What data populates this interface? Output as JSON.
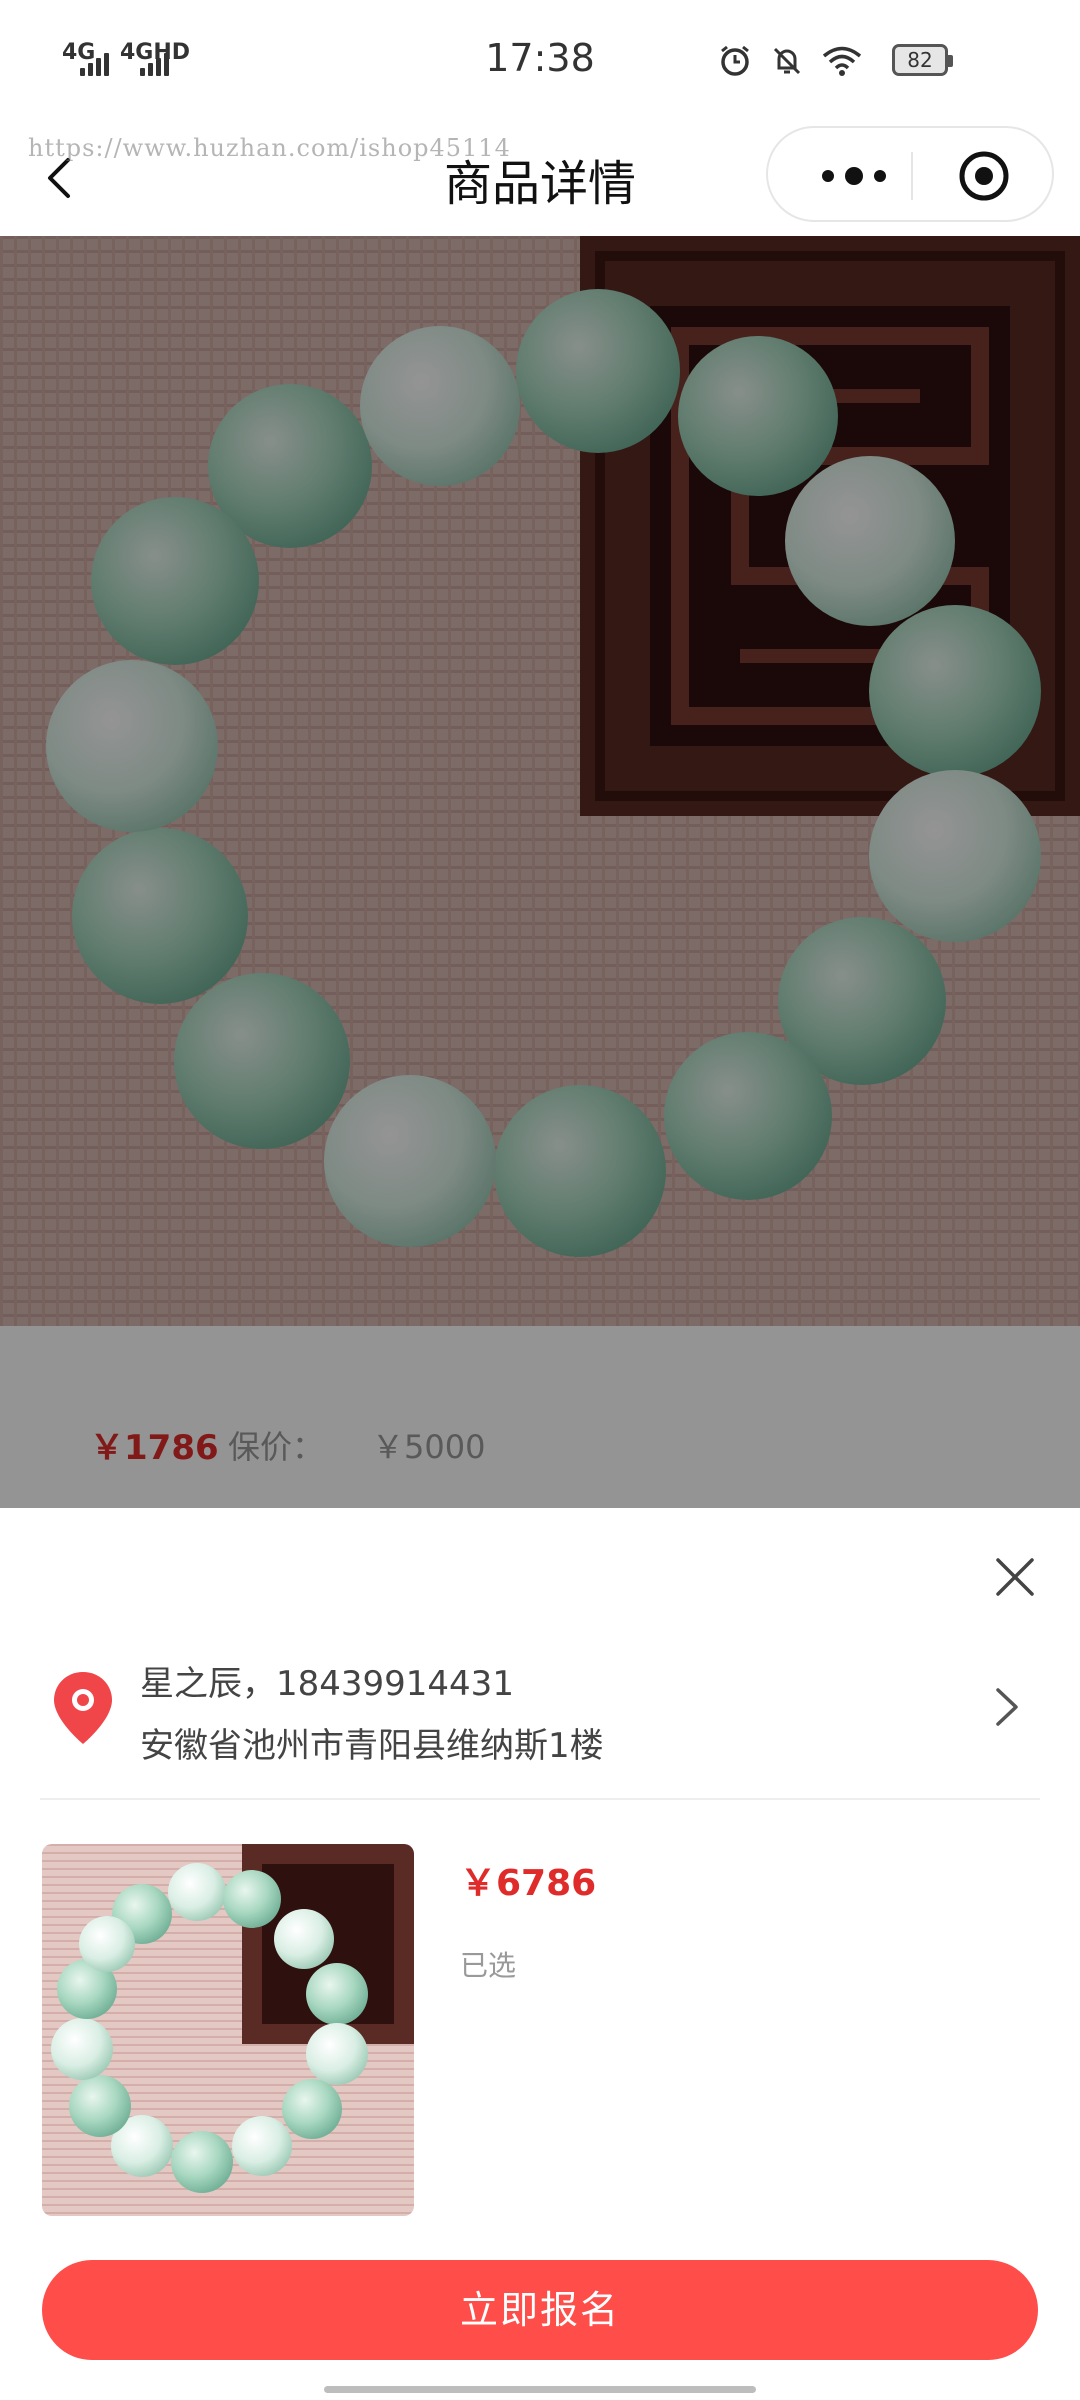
{
  "status_bar": {
    "network_1": "4G",
    "network_2": "4GHD",
    "time": "17:38",
    "battery": "82",
    "icons": [
      "alarm-icon",
      "mute-icon",
      "wifi-icon",
      "battery-icon"
    ]
  },
  "nav": {
    "title": "商品详情",
    "watermark": "https://www.huzhan.com/ishop45114",
    "icons": [
      "back-icon",
      "more-icon",
      "target-icon"
    ]
  },
  "product_card": {
    "price": "￥1786",
    "original_price_label": "保价：",
    "original_price": "￥5000"
  },
  "sheet": {
    "address": {
      "contact": "星之辰，18439914431",
      "detail": "安徽省池州市青阳县维纳斯1楼"
    },
    "price": "￥6786",
    "selected_label": "已选",
    "submit_label": "立即报名"
  },
  "colors": {
    "accent": "#ff4d4a",
    "price_red": "#e02b2b",
    "jade": "#9fd3b8"
  }
}
